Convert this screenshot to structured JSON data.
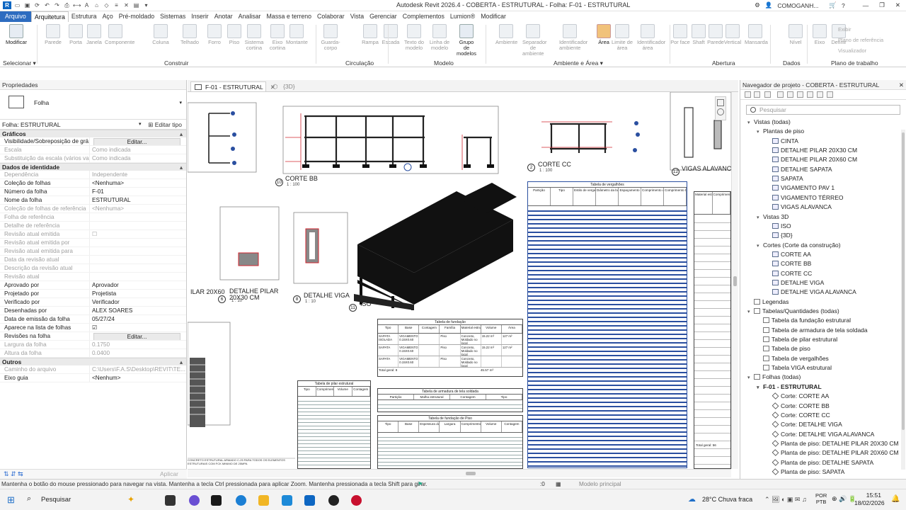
{
  "window": {
    "title": "Autodesk Revit 2026.4 - COBERTA - ESTRUTURAL - Folha: F-01 - ESTRUTURAL",
    "user": "COMOGANH..."
  },
  "menu": [
    "Arquivo",
    "Arquitetura",
    "Estrutura",
    "Aço",
    "Pré-moldado",
    "Sistemas",
    "Inserir",
    "Anotar",
    "Analisar",
    "Massa e terreno",
    "Colaborar",
    "Vista",
    "Gerenciar",
    "Complementos",
    "Lumion®",
    "Modificar"
  ],
  "ribbon": {
    "buttons": [
      {
        "label": "Modificar",
        "enabled": true
      },
      {
        "label": "Parede",
        "enabled": false
      },
      {
        "label": "Porta",
        "enabled": false
      },
      {
        "label": "Janela",
        "enabled": false
      },
      {
        "label": "Componente",
        "enabled": false
      },
      {
        "label": "Coluna",
        "enabled": false
      },
      {
        "label": "Telhado",
        "enabled": false
      },
      {
        "label": "Forro",
        "enabled": false
      },
      {
        "label": "Piso",
        "enabled": false
      },
      {
        "label": "Sistema cortina",
        "enabled": false
      },
      {
        "label": "Eixo cortina",
        "enabled": false
      },
      {
        "label": "Montante",
        "enabled": false
      },
      {
        "label": "Guarda-corpo",
        "enabled": false
      },
      {
        "label": "Rampa",
        "enabled": false
      },
      {
        "label": "Escada",
        "enabled": false
      },
      {
        "label": "Texto do modelo",
        "enabled": false
      },
      {
        "label": "Linha de modelo",
        "enabled": false
      },
      {
        "label": "Grupo de modelos",
        "enabled": true
      },
      {
        "label": "Ambiente",
        "enabled": false
      },
      {
        "label": "Separador de ambiente",
        "enabled": false
      },
      {
        "label": "Identificador ambiente",
        "enabled": false
      },
      {
        "label": "Área",
        "enabled": true
      },
      {
        "label": "Limite de área",
        "enabled": false
      },
      {
        "label": "Identificador área",
        "enabled": false
      },
      {
        "label": "Por face",
        "enabled": false
      },
      {
        "label": "Shaft",
        "enabled": false
      },
      {
        "label": "Parede",
        "enabled": false
      },
      {
        "label": "Vertical",
        "enabled": false
      },
      {
        "label": "Mansarda",
        "enabled": false
      },
      {
        "label": "Nível",
        "enabled": false
      },
      {
        "label": "Eixo",
        "enabled": false
      },
      {
        "label": "Definir",
        "enabled": false
      },
      {
        "label": "Exibir",
        "enabled": false
      },
      {
        "label": "Plano de referência",
        "enabled": false
      },
      {
        "label": "Visualizador",
        "enabled": false
      }
    ],
    "groups": [
      "Selecionar ▾",
      "Construir",
      "Circulação",
      "Modelo",
      "Ambiente e Área ▾",
      "Abertura",
      "Dados",
      "Plano de trabalho"
    ]
  },
  "properties": {
    "title": "Propriedades",
    "type_name": "Folha",
    "selector": "Folha: ESTRUTURAL",
    "edit_type": "Editar tipo",
    "sections": [
      {
        "name": "Gráficos",
        "rows": [
          {
            "k": "Visibilidade/Sobreposição de grá...",
            "v": "Editar...",
            "kind": "button"
          },
          {
            "k": "Escala",
            "v": "Como indicada",
            "dim": true
          },
          {
            "k": "Substituição da escala (vários val...",
            "v": "Como indicada",
            "dim": true
          }
        ]
      },
      {
        "name": "Dados de identidade",
        "rows": [
          {
            "k": "Dependência",
            "v": "Independente",
            "dim": true
          },
          {
            "k": "Coleção de folhas",
            "v": "<Nenhuma>"
          },
          {
            "k": "Número da folha",
            "v": "F-01"
          },
          {
            "k": "Nome da folha",
            "v": "ESTRUTURAL"
          },
          {
            "k": "Coleção de folhas de referência",
            "v": "<Nenhuma>",
            "dim": true
          },
          {
            "k": "Folha de referência",
            "v": "",
            "dim": true
          },
          {
            "k": "Detalhe de referência",
            "v": "",
            "dim": true
          },
          {
            "k": "Revisão atual emitida",
            "v": "☐",
            "dim": true
          },
          {
            "k": "Revisão atual emitida por",
            "v": "",
            "dim": true
          },
          {
            "k": "Revisão atual emitida para",
            "v": "",
            "dim": true
          },
          {
            "k": "Data da revisão atual",
            "v": "",
            "dim": true
          },
          {
            "k": "Descrição da revisão atual",
            "v": "",
            "dim": true
          },
          {
            "k": "Revisão atual",
            "v": "",
            "dim": true
          },
          {
            "k": "Aprovado por",
            "v": "Aprovador"
          },
          {
            "k": "Projetado por",
            "v": "Projetista"
          },
          {
            "k": "Verificado por",
            "v": "Verificador"
          },
          {
            "k": "Desenhadas por",
            "v": "ALEX SOARES"
          },
          {
            "k": "Data de emissão da folha",
            "v": "05/27/24"
          },
          {
            "k": "Aparece na lista de folhas",
            "v": "☑"
          },
          {
            "k": "Revisões na folha",
            "v": "Editar...",
            "kind": "button"
          },
          {
            "k": "Largura da folha",
            "v": "0.1750",
            "dim": true
          },
          {
            "k": "Altura da folha",
            "v": "0.0400",
            "dim": true
          }
        ]
      },
      {
        "name": "Outros",
        "rows": [
          {
            "k": "Caminho do arquivo",
            "v": "C:\\Users\\F.A.S\\Desktop\\REVIT\\TE...",
            "dim": true
          },
          {
            "k": "Eixo guia",
            "v": "<Nenhum>"
          }
        ]
      }
    ],
    "apply": "Aplicar"
  },
  "tabs": {
    "active": "F-01 - ESTRUTURAL",
    "other": "{3D}"
  },
  "sheet": {
    "views": [
      {
        "num": "10",
        "name": "CORTE BB",
        "scale": "1 : 100"
      },
      {
        "num": "2",
        "name": "CORTE CC",
        "scale": "1 : 100"
      },
      {
        "num": "12",
        "name": "VIGAS ALAVANCA",
        "scale": ""
      },
      {
        "num": "6",
        "name": "DETALHE PILAR 20X30 CM",
        "scale": "1 : 10"
      },
      {
        "num": "8",
        "name": "DETALHE VIGA",
        "scale": "1 : 10"
      },
      {
        "num": "11",
        "name": "ISO",
        "scale": ""
      }
    ],
    "pilar_left": "ILAR 20X60",
    "tables": {
      "vergalhoes": "Tabela de vergalhões",
      "vergalhoes_cols": [
        "Partição",
        "Tipo",
        "Estilo de vergalhão",
        "Diâmetro da barra",
        "Espaçamento",
        "Comprimento da barra",
        "Comprimento total da barra"
      ],
      "fundacao": "Tabela de fundação",
      "fundacao_cols": [
        "Tipo",
        "Base",
        "Contagem",
        "Família",
        "Material estrutural",
        "Volume",
        "Área"
      ],
      "fundacao_rows": [
        [
          "SAPATA ISOLADA",
          "VIGAMENTO 0.15X0.60",
          "",
          "Piso",
          "Concreto, Moldado no local",
          "15.22 m³",
          "127 m²"
        ],
        [
          "SAPATA",
          "VIGAMENTO 0.15X0.60",
          "",
          "Piso",
          "Concreto, Moldado no local",
          "15.22 m³",
          "127 m²"
        ],
        [
          "SAPATA",
          "VIGAMENTO 0.15X0.60",
          "",
          "Piso",
          "Concreto, Moldado no local",
          "",
          "",
          ""
        ]
      ],
      "fundacao_total": "Total geral: 8",
      "fundacao_volume": "45.57 m³",
      "pilar": "Tabela de pilar estrutural",
      "pilar_cols": [
        "Tipo",
        "Comprimento",
        "Volume",
        "Contagem"
      ],
      "armadura": "Tabela de armadura de tela soldada",
      "armadura_cols": [
        "Partição",
        "Malha estrutural",
        "Contagem",
        "Tipo"
      ],
      "piso": "Tabela de fundação de Piso",
      "piso_cols": [
        "Tipo",
        "Base",
        "Espessura da Fundação",
        "Largura",
        "Comprimento",
        "Volume",
        "Contagem"
      ],
      "right_col": [
        "Material estrutural",
        "Comprimento"
      ],
      "right_total": "Total geral: 56",
      "note": "CONCRETO ESTRUTURAL ARMADO C-25 PARA TODOS OS ELEMENTOS ESTRUTURAIS COM FCK MINIMO DE 25MPA"
    }
  },
  "browser": {
    "title": "Navegador de projeto - COBERTA - ESTRUTURAL",
    "search": "Pesquisar",
    "items": [
      {
        "t": "Vistas (todas)",
        "l": 0,
        "tog": "▾"
      },
      {
        "t": "Plantas de piso",
        "l": 1,
        "tog": "▾"
      },
      {
        "t": "CINTA",
        "l": 2,
        "ic": "plan"
      },
      {
        "t": "DETALHE PILAR 20X30 CM",
        "l": 2,
        "ic": "plan"
      },
      {
        "t": "DETALHE PILAR 20X60 CM",
        "l": 2,
        "ic": "plan"
      },
      {
        "t": "DETALHE SAPATA",
        "l": 2,
        "ic": "plan"
      },
      {
        "t": "SAPATA",
        "l": 2,
        "ic": "plan"
      },
      {
        "t": "VIGAMENTO PAV 1",
        "l": 2,
        "ic": "plan"
      },
      {
        "t": "VIGAMENTO TÉRREO",
        "l": 2,
        "ic": "plan"
      },
      {
        "t": "VIGAS ALAVANCA",
        "l": 2,
        "ic": "plan"
      },
      {
        "t": "Vistas 3D",
        "l": 1,
        "tog": "▾"
      },
      {
        "t": "ISO",
        "l": 2,
        "ic": "plan"
      },
      {
        "t": "{3D}",
        "l": 2,
        "ic": "plan"
      },
      {
        "t": "Cortes (Corte da construção)",
        "l": 1,
        "tog": "▾"
      },
      {
        "t": "CORTE AA",
        "l": 2,
        "ic": "plan"
      },
      {
        "t": "CORTE BB",
        "l": 2,
        "ic": "plan"
      },
      {
        "t": "CORTE CC",
        "l": 2,
        "ic": "plan"
      },
      {
        "t": "DETALHE VIGA",
        "l": 2,
        "ic": "plan"
      },
      {
        "t": "DETALHE VIGA ALAVANCA",
        "l": 2,
        "ic": "plan"
      },
      {
        "t": "Legendas",
        "l": 0,
        "tog": "",
        "ic": "sheet"
      },
      {
        "t": "Tabelas/Quantidades (todas)",
        "l": 0,
        "tog": "▾",
        "ic": "sheet"
      },
      {
        "t": "Tabela da fundação estrutural",
        "l": 1,
        "ic": "sheet"
      },
      {
        "t": "Tabela de armadura de tela soldada",
        "l": 1,
        "ic": "sheet"
      },
      {
        "t": "Tabela de pilar estrutural",
        "l": 1,
        "ic": "sheet"
      },
      {
        "t": "Tabela de piso",
        "l": 1,
        "ic": "sheet"
      },
      {
        "t": "Tabela de vergalhões",
        "l": 1,
        "ic": "sheet"
      },
      {
        "t": "Tabela VIGA estrutural",
        "l": 1,
        "ic": "sheet"
      },
      {
        "t": "Folhas (todas)",
        "l": 0,
        "tog": "▾",
        "ic": "sheet"
      },
      {
        "t": "F-01 - ESTRUTURAL",
        "l": 1,
        "tog": "▾",
        "bold": true
      },
      {
        "t": "Corte: CORTE AA",
        "l": 2,
        "ic": "view"
      },
      {
        "t": "Corte: CORTE BB",
        "l": 2,
        "ic": "view"
      },
      {
        "t": "Corte: CORTE CC",
        "l": 2,
        "ic": "view"
      },
      {
        "t": "Corte: DETALHE VIGA",
        "l": 2,
        "ic": "view"
      },
      {
        "t": "Corte: DETALHE VIGA ALAVANCA",
        "l": 2,
        "ic": "view"
      },
      {
        "t": "Planta de piso: DETALHE PILAR 20X30 CM",
        "l": 2,
        "ic": "view"
      },
      {
        "t": "Planta de piso: DETALHE PILAR 20X60 CM",
        "l": 2,
        "ic": "view"
      },
      {
        "t": "Planta de piso: DETALHE SAPATA",
        "l": 2,
        "ic": "view"
      },
      {
        "t": "Planta de piso: SAPATA",
        "l": 2,
        "ic": "view"
      }
    ]
  },
  "status": {
    "hint": "Mantenha o botão do mouse pressionado para navegar na vista. Mantenha a tecla Ctrl pressionada para aplicar Zoom. Mantenha pressionada a tecla Shift para girar.",
    "model": "Modelo principal",
    "zero": ":0"
  },
  "taskbar": {
    "search": "Pesquisar",
    "weather": "28°C  Chuva fraca",
    "lang1": "POR",
    "lang2": "PTB",
    "time": "15:51",
    "date": "18/02/2026"
  }
}
